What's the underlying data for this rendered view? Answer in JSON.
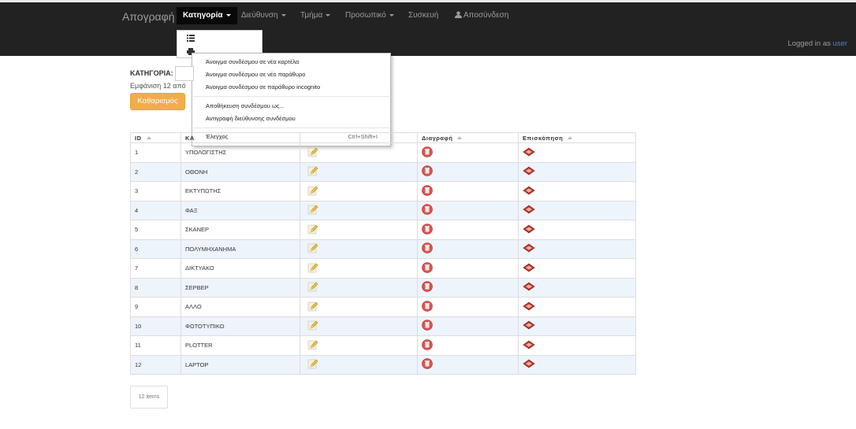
{
  "navbar": {
    "brand": "Απογραφή",
    "items": [
      {
        "label": "Κατηγορία"
      },
      {
        "label": "Διεύθυνση"
      },
      {
        "label": "Τμήμα"
      },
      {
        "label": "Προσωπικό"
      },
      {
        "label": "Συσκευή"
      },
      {
        "label": "Αποσύνδεση"
      }
    ],
    "logged_prefix": "Logged in as",
    "username": "user"
  },
  "context_menu": {
    "items": [
      "Άνοιγμα συνδέσμου σε νέα καρτέλα",
      "Άνοιγμα συνδέσμου σε νέο παράθυρο",
      "Άνοιγμα συνδέσμου σε παράθυρο incognito",
      "Αποθήκευση συνδέσμου ως...",
      "Αντιγραφή διεύθυνσης συνδέσμου",
      "Έλεγχος"
    ],
    "inspect_shortcut": "Ctrl+Shift+I"
  },
  "filter": {
    "label": "ΚΑΤΗΓΟΡΙΑ:",
    "showing": "Εμφάνιση 12 από",
    "clear_button": "Καθαρισμός"
  },
  "table": {
    "headers": [
      "ID",
      "ΚΑ",
      "",
      "Διαγραφή",
      "Επισκόπηση"
    ],
    "rows": [
      {
        "id": "1",
        "name": "ΥΠΟΛΟΓΙΣΤΗΣ"
      },
      {
        "id": "2",
        "name": "ΟΘΟΝΗ"
      },
      {
        "id": "3",
        "name": "ΕΚΤΥΠΩΤΗΣ"
      },
      {
        "id": "4",
        "name": "ΦΑΞ"
      },
      {
        "id": "5",
        "name": "ΣΚΑΝΕΡ"
      },
      {
        "id": "6",
        "name": "ΠΟΛΥΜΗΧΑΝΗΜΑ"
      },
      {
        "id": "7",
        "name": "ΔΙΚΤΥΑΚΟ"
      },
      {
        "id": "8",
        "name": "ΣΕΡΒΕΡ"
      },
      {
        "id": "9",
        "name": "ΑΛΛΟ"
      },
      {
        "id": "10",
        "name": "ΦΩΤΟΤΥΠΙΚΟ"
      },
      {
        "id": "11",
        "name": "PLOTTER"
      },
      {
        "id": "12",
        "name": "LAPTOP"
      }
    ]
  },
  "pager": {
    "label": "12 items"
  },
  "colors": {
    "navbar": "#222222",
    "accent": "#f0ad4e",
    "link": "#428bca",
    "alt_row": "#eef4fc"
  },
  "icons": {
    "edit": "pencil-icon",
    "delete": "delete-icon",
    "view": "view-book-icon"
  }
}
